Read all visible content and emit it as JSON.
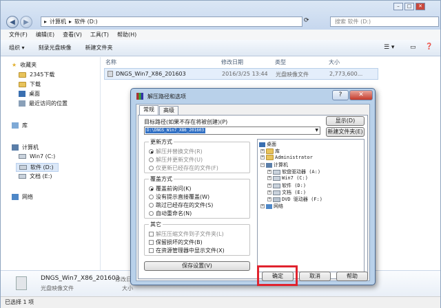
{
  "explorer": {
    "path": [
      "计算机",
      "软件 (D:)"
    ],
    "search_placeholder": "搜索 软件 (D:)",
    "menu": [
      "文件(F)",
      "编辑(E)",
      "查看(V)",
      "工具(T)",
      "帮助(H)"
    ],
    "toolbar": [
      "组织 ▾",
      "刻录光盘映像",
      "新建文件夹"
    ],
    "nav": {
      "favorites": "收藏夹",
      "fav_items": [
        "2345下载",
        "下载",
        "桌面",
        "最近访问的位置"
      ],
      "library": "库",
      "computer": "计算机",
      "drives": [
        "Win7 (C:)",
        "软件 (D:)",
        "文档 (E:)"
      ],
      "network": "网络"
    },
    "columns": [
      "名称",
      "修改日期",
      "类型",
      "大小"
    ],
    "file": {
      "name": "DNGS_Win7_X86_201603",
      "date": "2016/3/25 13:44",
      "type": "光盘映像文件",
      "size": "2,773,600..."
    },
    "details": {
      "name": "DNGS_Win7_X86_201603",
      "date_label": "修改日",
      "type": "光盘映像文件",
      "size_label": "大小"
    },
    "status": "已选择 1 项"
  },
  "dialog": {
    "title": "解压路径和选项",
    "tabs": [
      "常规",
      "高级"
    ],
    "target_label": "目标路径(如果不存在将被创建)(P)",
    "target_value": "D:\\DNGS_Win7_X86_201603",
    "show_button": "显示(D)",
    "new_folder_button": "新建文件夹(E)",
    "update_group": "更新方式",
    "update_options": [
      "解压并替换文件(R)",
      "解压并更新文件(U)",
      "仅更新已经存在的文件(F)"
    ],
    "overwrite_group": "覆盖方式",
    "overwrite_options": [
      "覆盖前询问(K)",
      "没有提示直接覆盖(W)",
      "跳过已经存在的文件(S)",
      "自动重命名(N)"
    ],
    "other_group": "其它",
    "other_options": [
      "解压压缩文件到子文件夹(L)",
      "保留损坏的文件(B)",
      "在资源管理器中显示文件(X)"
    ],
    "save_button": "保存设置(V)",
    "tree": {
      "desktop": "桌面",
      "library": "库",
      "admin": "Administrator",
      "computer": "计算机",
      "drives": [
        "软盘驱动器 (A:)",
        "Win7 (C:)",
        "软件 (D:)",
        "文档 (E:)",
        "DVD 驱动器 (F:)"
      ],
      "network": "网络"
    },
    "ok_button": "确定",
    "cancel_button": "取消",
    "help_button": "帮助",
    "help_icon": "?",
    "close_icon": "✕"
  }
}
